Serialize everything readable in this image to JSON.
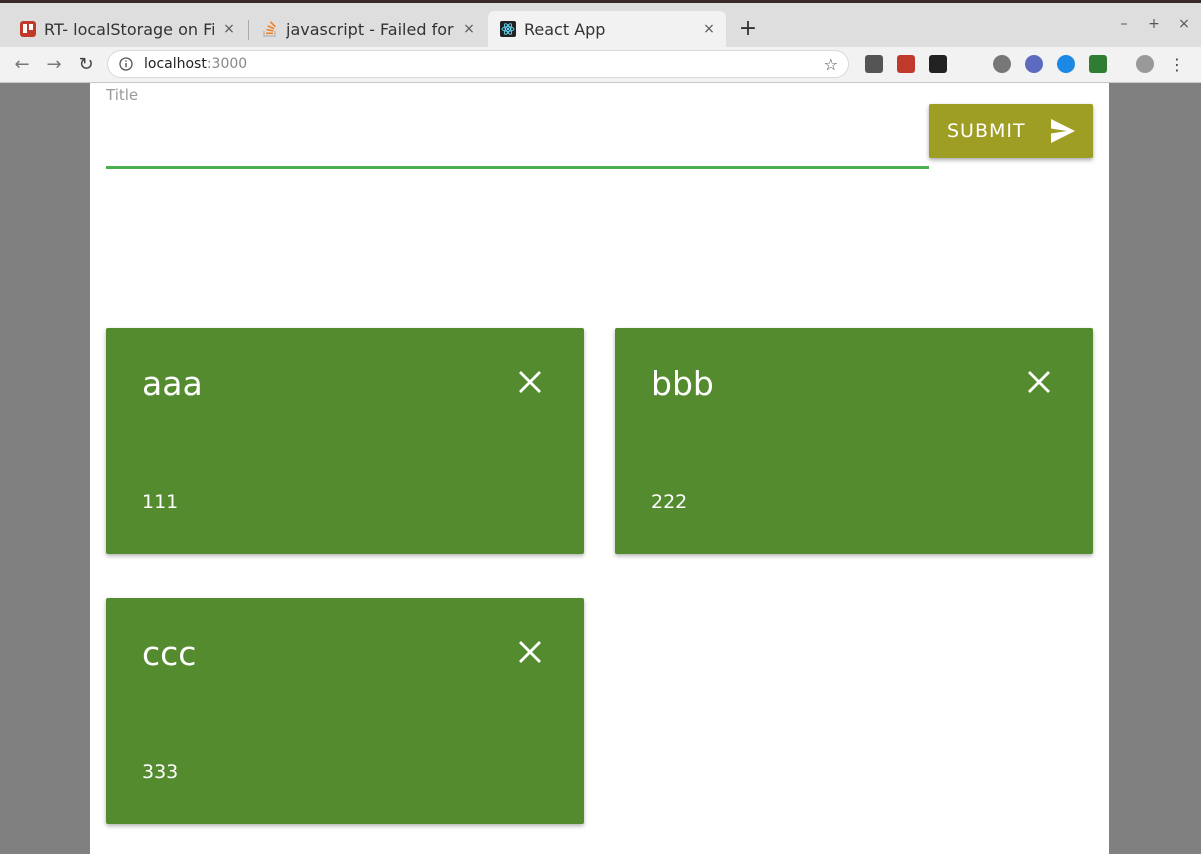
{
  "browser": {
    "tabs": [
      {
        "label": "RT- localStorage on Fir",
        "close": "×",
        "icon": "trello-icon",
        "active": false
      },
      {
        "label": "javascript - Failed form",
        "close": "×",
        "icon": "stackoverflow-icon",
        "active": false
      },
      {
        "label": "React App",
        "close": "×",
        "icon": "react-icon",
        "active": true
      }
    ],
    "new_tab": "+",
    "window_controls": {
      "minimize": "–",
      "maximize": "+",
      "close": "×"
    },
    "nav": {
      "back": "←",
      "forward": "→",
      "reload": "↻"
    },
    "address": {
      "host": "localhost",
      "port": ":3000"
    },
    "star": "☆",
    "menu": "⋮",
    "extensions": [
      "lightbulb-icon",
      "puzzle-icon",
      "terminal-icon",
      "dots-icon",
      "settings-icon",
      "r-icon",
      "circle-icon",
      "shield-icon",
      "alien-icon"
    ]
  },
  "form": {
    "title_label": "Title",
    "title_value": "",
    "submit_label": "SUBMIT"
  },
  "cards": [
    {
      "title": "aaa",
      "body": "111"
    },
    {
      "title": "bbb",
      "body": "222"
    },
    {
      "title": "ccc",
      "body": "333"
    }
  ],
  "colors": {
    "card": "#558b2f",
    "submit": "#9e9d24",
    "input_underline": "#4caf50",
    "backdrop": "#808080"
  }
}
